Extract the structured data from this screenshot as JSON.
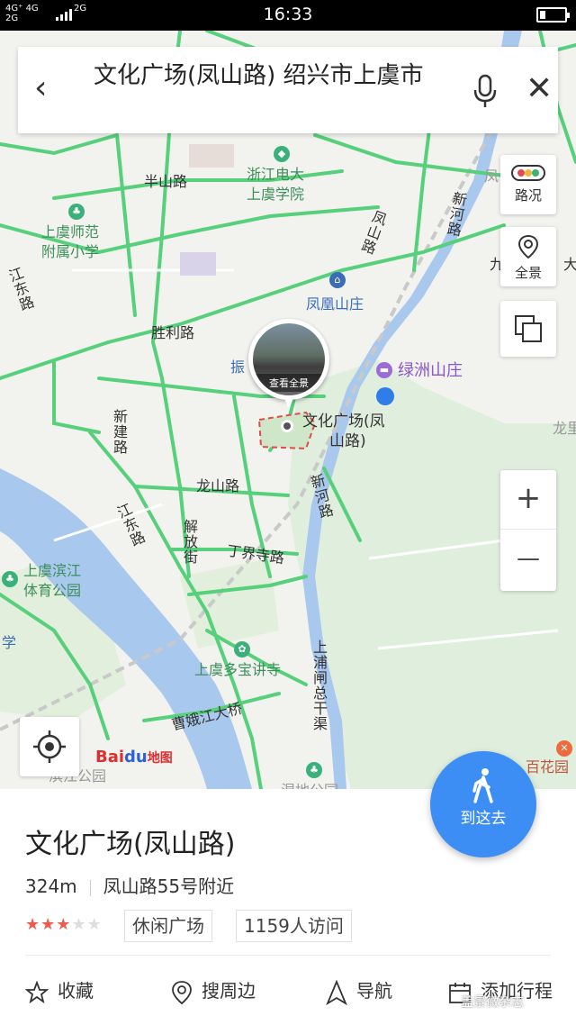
{
  "status_bar": {
    "network_top": "4G⁺ 4G",
    "network_bottom": "2G",
    "network_right": "2G",
    "time": "16:33"
  },
  "search": {
    "query": "文化广场(凤山路) 绍兴市上虞市"
  },
  "map": {
    "labels": {
      "banshan_road": "半山路",
      "zhejiang_dianda": "浙江电大",
      "shangyu_xueyuan": "上虞学院",
      "shangyu_normal_1": "上虞师范",
      "shangyu_normal_2": "附属小学",
      "fengshan_road": "凤山路",
      "xinhe_road_top": "新河路",
      "jiangdong_road_top": "江东路",
      "fenghuang_shanzhuang": "凤凰山庄",
      "shengli_road": "胜利路",
      "lvzhou_shanzhuang": "绿洲山庄",
      "zhen": "振",
      "xinjian_road": "新建路",
      "culture_square_1": "文化广场(凤",
      "culture_square_2": "山路)",
      "longshan_road": "龙山路",
      "xinhe_road_mid": "新河路",
      "jiangdong_road_mid": "江东路",
      "jiefang_street": "解放街",
      "dingjiesi_road": "丁界寺路",
      "binjiang_park_1": "上虞滨江",
      "binjiang_park_2": "体育公园",
      "xue": "学",
      "duobao_temple": "上虞多宝讲寺",
      "shangpuzha_canal": "上浦闸总干渠",
      "caoejiang_bridge": "曹娥江大桥",
      "baihuayuan": "百花园",
      "long_right": "龙里",
      "da_right": "大",
      "jiu_right": "九",
      "feng_right": "凤",
      "bottom_cut_left": "滨江公园",
      "bottom_cut_mid": "湿地公园"
    },
    "panorama_caption": "查看全景",
    "logo_text": "Bai",
    "logo_paw": "du",
    "logo_suffix": "地图",
    "accent_road": "#56d07a",
    "water": "#a9c8ee",
    "green_area": "#dcefd9"
  },
  "controls": {
    "traffic": "路况",
    "panorama": "全景",
    "layers_icon": "layers-icon",
    "zoom_in": "+",
    "zoom_out": "—"
  },
  "fab": {
    "label": "到这去",
    "color": "#3d8ef4"
  },
  "place": {
    "name": "文化广场(凤山路)",
    "distance": "324m",
    "address": "凤山路55号附近",
    "rating": 3,
    "rating_max": 5,
    "tag_category": "休闲广场",
    "tag_visits": "1159人访问"
  },
  "actions": {
    "favorite": "收藏",
    "nearby": "搜周边",
    "navigate": "导航",
    "add_trip": "添加行程"
  },
  "watermark": "盖景微杂志"
}
